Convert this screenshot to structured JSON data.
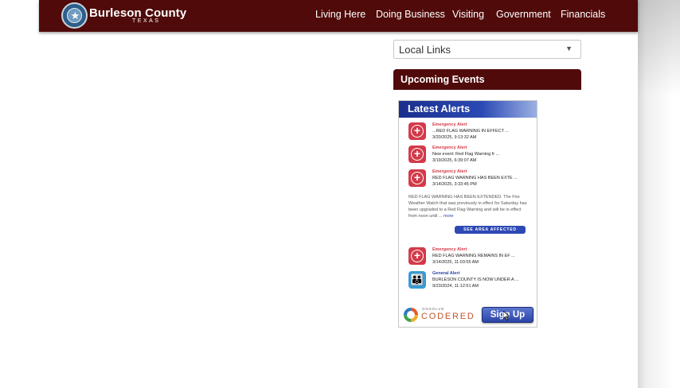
{
  "header": {
    "title": "Burleson County",
    "subtitle": "TEXAS",
    "nav": [
      "Living Here",
      "Doing Business",
      "Visiting",
      "Government",
      "Financials"
    ]
  },
  "local_links": {
    "selected": "Local Links"
  },
  "upcoming_events": {
    "title": "Upcoming Events"
  },
  "alerts_widget": {
    "title": "Latest Alerts",
    "alerts": [
      {
        "type": "Emergency Alert",
        "message": "...RED FLAG WARNING IN EFFECT ...",
        "time": "3/20/2025, 9:13:32 AM"
      },
      {
        "type": "Emergency Alert",
        "message": "New event: Red Flag Warning fr ...",
        "time": "3/19/2025, 6:39:07 AM"
      },
      {
        "type": "Emergency Alert",
        "message": "RED FLAG WARNING HAS BEEN EXTE ...",
        "time": "3/14/2025, 3:33:45 PM"
      },
      {
        "type": "Emergency Alert",
        "message": "RED FLAG WARNING REMAINS IN EF ...",
        "time": "3/14/2025, 11:03:55 AM"
      },
      {
        "type": "General Alert",
        "message": "BURLESON COUNTY IS NOW UNDER A ...",
        "time": "9/23/2024, 11:12:51 AM"
      }
    ],
    "description": "RED FLAG WARNING HAS BEEN EXTENDED. The Fire Weather Watch that was previously in effect for Saturday has been upgraded to a Red Flag Warning and will be in effect from noon until ...",
    "more_label": "more",
    "area_button": "SEE AREA AFFECTED",
    "brand_small": "ONSOLVE",
    "brand_big": "CODERED",
    "signup_label": "Sign Up"
  }
}
